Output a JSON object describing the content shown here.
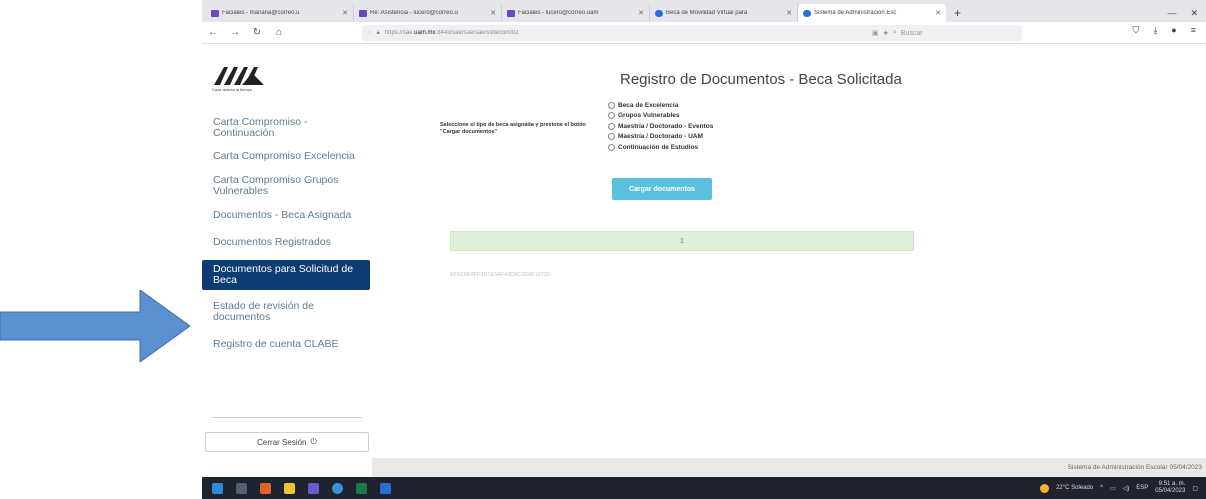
{
  "browser": {
    "tabs": [
      {
        "title": "Faciales - mariana@correo.u",
        "icon": "purple-square-icon",
        "active": false
      },
      {
        "title": "Re: Asistencia - lucero@correo.u",
        "icon": "purple-square-icon",
        "active": false
      },
      {
        "title": "Faciales - lucero@correo.uam",
        "icon": "purple-square-icon",
        "active": false
      },
      {
        "title": "Beca de Movilidad Virtual para",
        "icon": "cloud-icon",
        "active": false
      },
      {
        "title": "Sistema de Administración Esc",
        "icon": "cloud-icon",
        "active": true
      }
    ],
    "new_tab": "+",
    "url_prefix": "https://sae.",
    "url_domain": "uam.mx",
    "url_rest": ":8443/sae/sae/sae/ssbecon002",
    "search_placeholder": "Buscar"
  },
  "sidebar": {
    "slogan": "Casa abierta al tiempo",
    "items": [
      {
        "label": "Carta Compromiso - Continuación",
        "active": false
      },
      {
        "label": "Carta Compromiso Excelencia",
        "active": false
      },
      {
        "label": "Carta Compromiso Grupos Vulnerables",
        "active": false
      },
      {
        "label": "Documentos - Beca Asignada",
        "active": false
      },
      {
        "label": "Documentos Registrados",
        "active": false
      },
      {
        "label": "Documentos para Solicitud de Beca",
        "active": true
      },
      {
        "label": "Estado de revisión de documentos",
        "active": false
      },
      {
        "label": "Registro de cuenta CLABE",
        "active": false
      }
    ],
    "logout_label": "Cerrar Sesión"
  },
  "main": {
    "title": "Registro de Documentos - Beca Solicitada",
    "prompt": "Seleccione el tipo de beca asignada y presione el botón \"Cargar documentos\"",
    "options": [
      "Beca de Excelencia",
      "Grupos Vulnerables",
      "Maestría / Doctorado - Eventos",
      "Maestría / Doctorado - UAM",
      "Continuación de Estudios"
    ],
    "upload_button": "Cargar documentos",
    "alert_text": "1",
    "hash_text": "AF5C6B9FF0D7E5AF43D8C2D0F1072D"
  },
  "footer": {
    "text": "Sistema de Administración Escolar 05/04/2023"
  },
  "taskbar": {
    "weather": "22°C Soleado",
    "language": "ESP",
    "time": "9:51 a. m.",
    "date": "05/04/2023"
  },
  "colors": {
    "accent_nav": "#0d3b73",
    "upload_button": "#5bc0de",
    "alert_bg": "#dff0d8",
    "arrow": "#5b8fd0"
  }
}
